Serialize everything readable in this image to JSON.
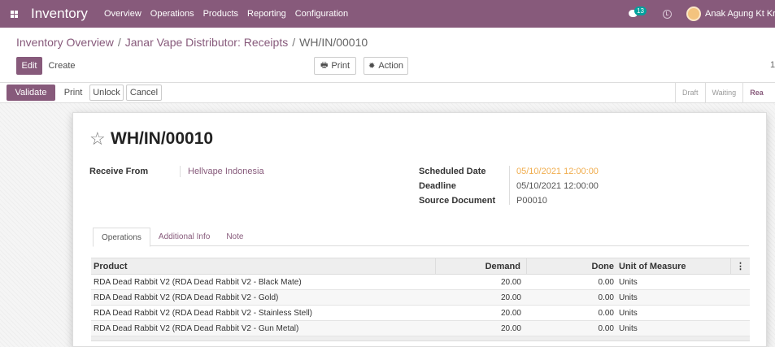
{
  "nav": {
    "app_name": "Inventory",
    "menu": [
      "Overview",
      "Operations",
      "Products",
      "Reporting",
      "Configuration"
    ],
    "chat_count": "13",
    "user_name": "Anak Agung Kt Kris"
  },
  "breadcrumb": {
    "parent": "Inventory Overview",
    "section": "Janar Vape Distributor: Receipts",
    "current": "WH/IN/00010"
  },
  "control": {
    "edit": "Edit",
    "create": "Create",
    "print": "Print",
    "action": "Action",
    "pager": "1"
  },
  "status_bar": {
    "buttons": [
      "Validate",
      "Print",
      "Unlock",
      "Cancel"
    ],
    "stages": [
      "Draft",
      "Waiting",
      "Ready"
    ],
    "current_stage": "Ready"
  },
  "record": {
    "name": "WH/IN/00010",
    "receive_from_label": "Receive From",
    "receive_from": "Hellvape Indonesia",
    "scheduled_date_label": "Scheduled Date",
    "scheduled_date": "05/10/2021 12:00:00",
    "deadline_label": "Deadline",
    "deadline": "05/10/2021 12:00:00",
    "source_document_label": "Source Document",
    "source_document": "P00010"
  },
  "tabs": [
    "Operations",
    "Additional Info",
    "Note"
  ],
  "table": {
    "headers": {
      "product": "Product",
      "demand": "Demand",
      "done": "Done",
      "uom": "Unit of Measure"
    },
    "rows": [
      {
        "product": "RDA Dead Rabbit V2 (RDA Dead Rabbit V2 - Black Mate)",
        "demand": "20.00",
        "done": "0.00",
        "uom": "Units"
      },
      {
        "product": "RDA Dead Rabbit V2 (RDA Dead Rabbit V2 - Gold)",
        "demand": "20.00",
        "done": "0.00",
        "uom": "Units"
      },
      {
        "product": "RDA Dead Rabbit V2 (RDA Dead Rabbit V2 - Stainless Stell)",
        "demand": "20.00",
        "done": "0.00",
        "uom": "Units"
      },
      {
        "product": "RDA Dead Rabbit V2 (RDA Dead Rabbit V2 - Gun Metal)",
        "demand": "20.00",
        "done": "0.00",
        "uom": "Units"
      }
    ]
  },
  "colors": {
    "brand": "#875a7b",
    "warning": "#f0ad4e",
    "badge": "#00a09d"
  }
}
